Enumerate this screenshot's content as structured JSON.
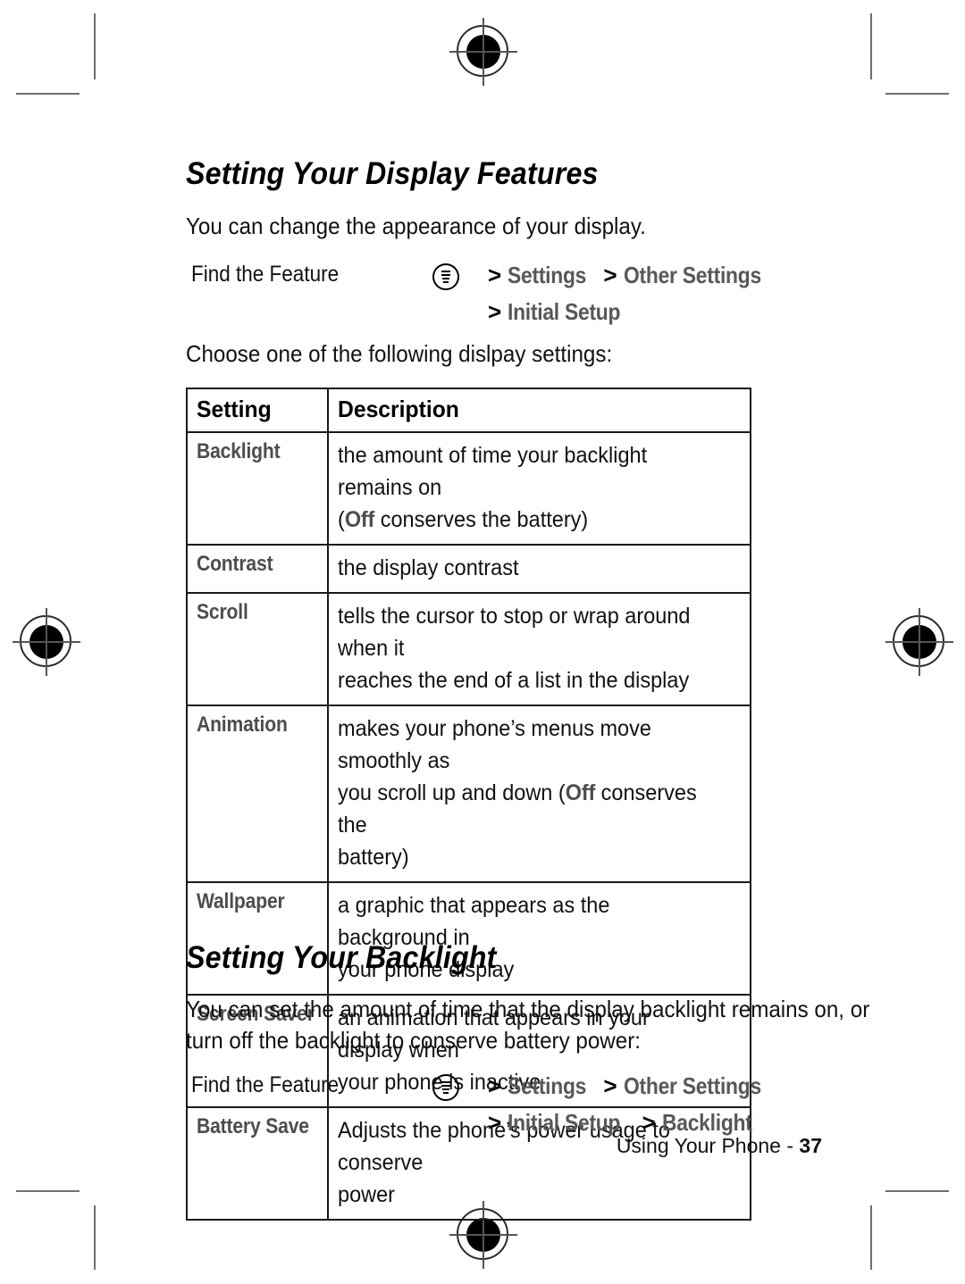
{
  "page": {
    "footer_label": "Using Your Phone -",
    "page_number": "37"
  },
  "sections": [
    {
      "heading": "Setting Your Display Features",
      "intro": "You can change the appearance of your display.",
      "find_feature": {
        "label": "Find the Feature",
        "icon": "menu-icon",
        "line1": [
          "Settings",
          "Other Settings"
        ],
        "line2": [
          "Initial Setup"
        ]
      },
      "table_intro": "Choose one of the following dislpay settings:"
    },
    {
      "heading": "Setting Your Backlight",
      "intro_line1": "You can set the amount of time that the display backlight remains on, or",
      "intro_line2": "turn off the backlight to conserve battery power:",
      "find_feature": {
        "label": "Find the Feature",
        "icon": "menu-icon",
        "line1": [
          "Settings",
          "Other Settings"
        ],
        "line2": [
          "Initial Setup",
          "Backlight"
        ]
      }
    }
  ],
  "table": {
    "headers": [
      "Setting",
      "Description"
    ],
    "rows": [
      {
        "setting": "Backlight",
        "lines": [
          [
            {
              "t": "the amount of time your backlight remains on",
              "kw": false
            }
          ],
          [
            {
              "t": "(",
              "kw": false
            },
            {
              "t": "Off",
              "kw": true
            },
            {
              "t": " conserves the battery)",
              "kw": false
            }
          ]
        ]
      },
      {
        "setting": "Contrast",
        "lines": [
          [
            {
              "t": "the display contrast",
              "kw": false
            }
          ]
        ]
      },
      {
        "setting": "Scroll",
        "lines": [
          [
            {
              "t": "tells the cursor to stop or wrap around when it",
              "kw": false
            }
          ],
          [
            {
              "t": "reaches the end of a list in the display",
              "kw": false
            }
          ]
        ]
      },
      {
        "setting": "Animation",
        "lines": [
          [
            {
              "t": "makes your phone’s menus move smoothly as",
              "kw": false
            }
          ],
          [
            {
              "t": "you scroll up and down (",
              "kw": false
            },
            {
              "t": "Off",
              "kw": true
            },
            {
              "t": " conserves the",
              "kw": false
            }
          ],
          [
            {
              "t": "battery)",
              "kw": false
            }
          ]
        ]
      },
      {
        "setting": "Wallpaper",
        "lines": [
          [
            {
              "t": "a graphic that appears as the background in",
              "kw": false
            }
          ],
          [
            {
              "t": "your phone display",
              "kw": false
            }
          ]
        ]
      },
      {
        "setting": "Screen Saver",
        "lines": [
          [
            {
              "t": "an animation that appears in your display when",
              "kw": false
            }
          ],
          [
            {
              "t": "your phone is inactive",
              "kw": false
            }
          ]
        ]
      },
      {
        "setting": "Battery Save",
        "lines": [
          [
            {
              "t": "Adjusts the phone’s power usage to conserve",
              "kw": false
            }
          ],
          [
            {
              "t": "power",
              "kw": false
            }
          ]
        ]
      }
    ]
  },
  "colors": {
    "text": "#111111",
    "setting_label": "#4d4d4d",
    "nav_step": "#585858",
    "rule": "#1a1a1a",
    "crop_mark": "#6e6e6e"
  }
}
